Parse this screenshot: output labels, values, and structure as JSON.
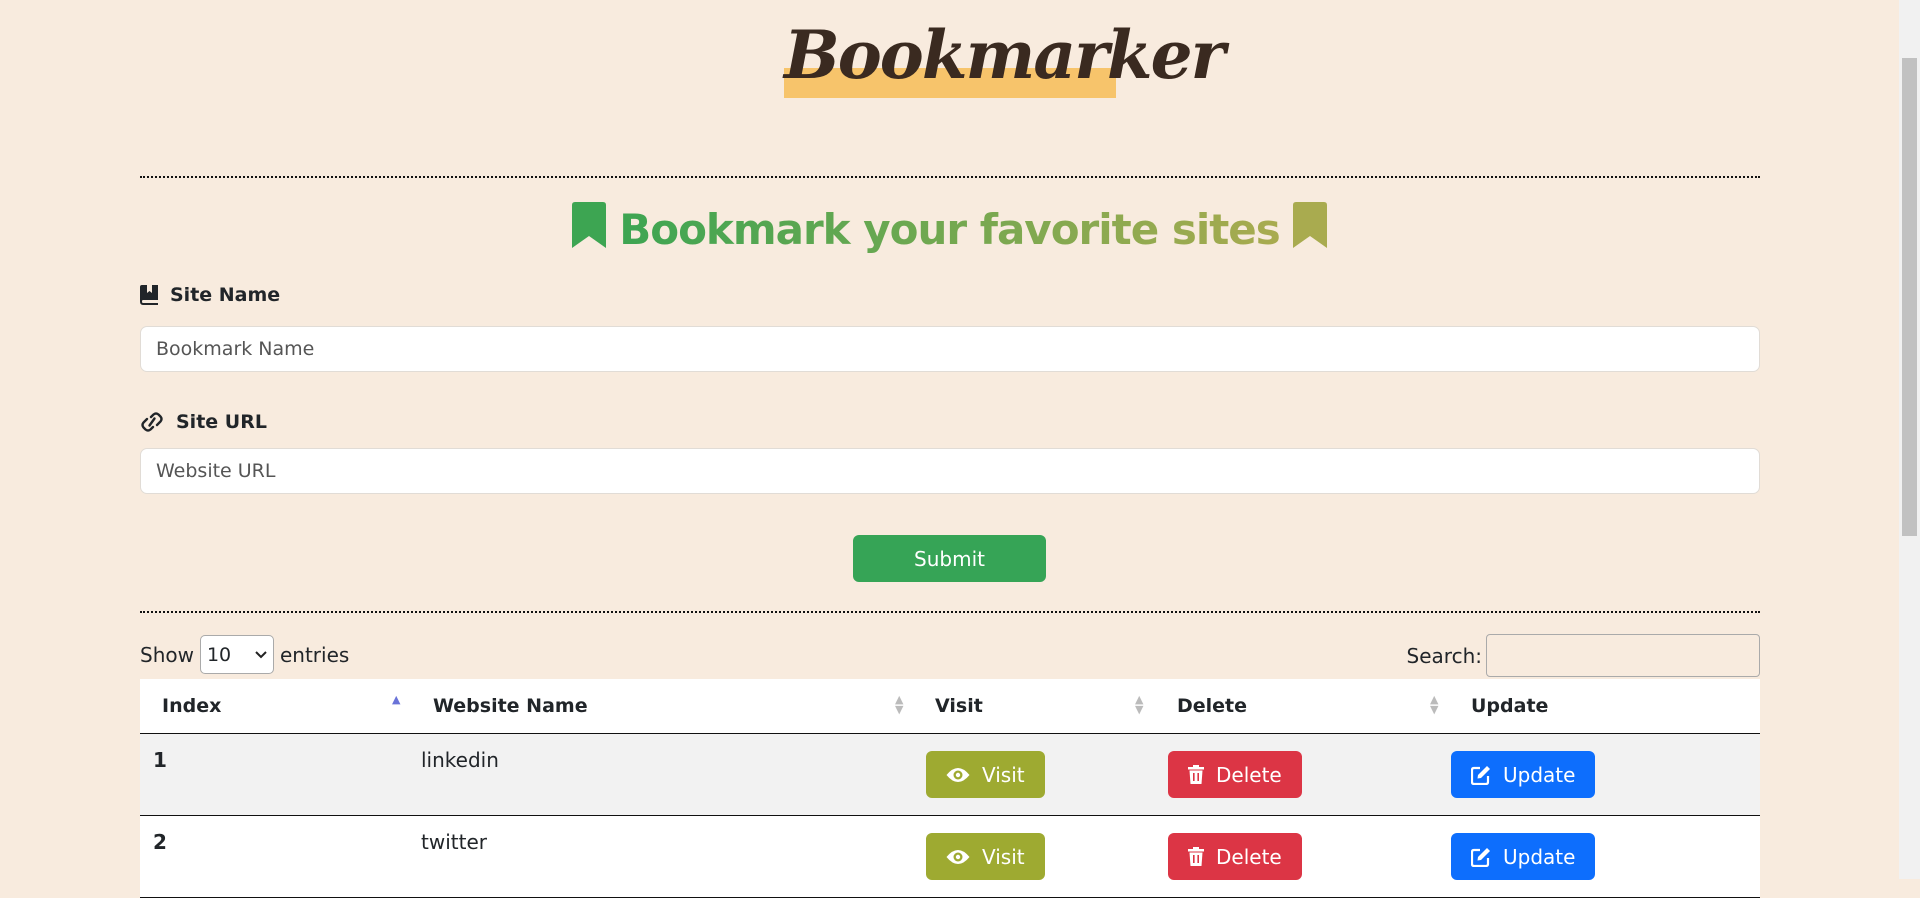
{
  "app": {
    "logo": "Bookmarker"
  },
  "headline": {
    "text": "Bookmark your favorite sites"
  },
  "colors": {
    "background": "#f8ebde",
    "accent_green": "#36a456",
    "visit": "#9eaa31",
    "delete": "#dc3545",
    "update": "#0d6efd",
    "logo_highlight": "#f7c46b"
  },
  "form": {
    "site_name_label": "Site Name",
    "site_name_placeholder": "Bookmark Name",
    "site_url_label": "Site URL",
    "site_url_placeholder": "Website URL",
    "submit_label": "Submit"
  },
  "table_controls": {
    "show_label": "Show",
    "entries_value": "10",
    "entries_label": "entries",
    "search_label": "Search:"
  },
  "table": {
    "headers": [
      "Index",
      "Website Name",
      "Visit",
      "Delete",
      "Update"
    ],
    "sort_column": "Index",
    "sort_direction": "ascending",
    "rows": [
      {
        "index": "1",
        "name": "linkedin",
        "visit": "Visit",
        "delete": "Delete",
        "update": "Update"
      },
      {
        "index": "2",
        "name": "twitter",
        "visit": "Visit",
        "delete": "Delete",
        "update": "Update"
      }
    ]
  },
  "icons": {
    "headline_left": "bookmark-icon",
    "headline_right": "bookmark-icon",
    "site_name": "book-bookmark-icon",
    "site_url": "link-icon",
    "visit": "eye-icon",
    "delete": "trash-icon",
    "update": "edit-icon"
  }
}
